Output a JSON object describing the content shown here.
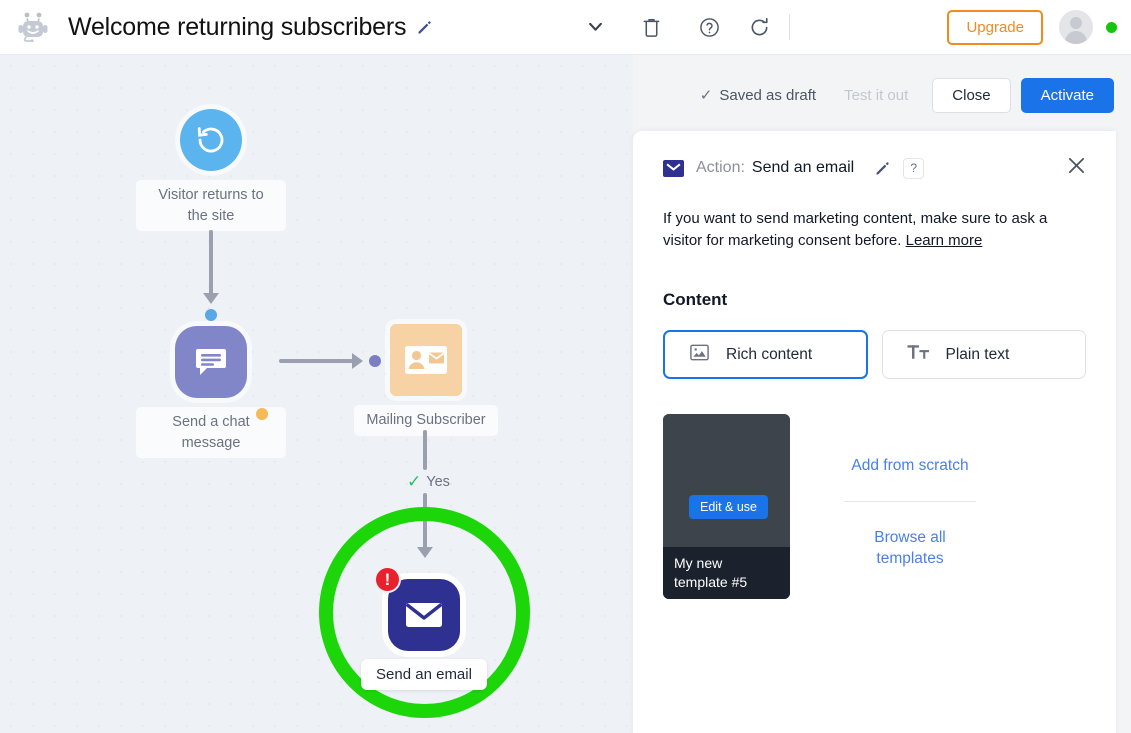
{
  "topbar": {
    "logo_icon": "chatbot-logo-icon",
    "title": "Welcome returning subscribers",
    "title_edit_icon": "pencil-icon",
    "icons": [
      "chevron-down-icon",
      "trash-icon",
      "help-circle-icon",
      "refresh-icon"
    ],
    "upgrade_label": "Upgrade",
    "avatar_icon": "user-avatar",
    "status_color": "#16c60c"
  },
  "actionbar": {
    "saved_label": "Saved as draft",
    "saved_check_icon": "check-icon",
    "test_label": "Test it out",
    "close_label": "Close",
    "activate_label": "Activate",
    "activate_color": "#1a73e8"
  },
  "canvas": {
    "nodes": [
      {
        "id": "trigger",
        "label": "Visitor returns to the site",
        "icon": "rotate-back-icon",
        "color": "#5cb4ef"
      },
      {
        "id": "chat",
        "label": "Send a chat message",
        "icon": "chat-bubble-icon",
        "color": "#8086c8"
      },
      {
        "id": "mailing-subscriber",
        "label": "Mailing Subscriber",
        "icon": "contact-card-icon",
        "color": "#f7d2a4"
      },
      {
        "id": "send-email",
        "label": "Send an email",
        "icon": "envelope-icon",
        "color": "#2f3192",
        "alert": "!",
        "highlight_color": "#1cd60a"
      }
    ],
    "branch_label": "Yes",
    "branch_check_icon": "check-icon",
    "connector_color": "#9aa0b0",
    "dot_colors": {
      "blue": "#58a8e8",
      "orange": "#f7b955",
      "purple": "#7a7fc4"
    }
  },
  "panel": {
    "mail_icon": "envelope-icon",
    "action_word": "Action:",
    "action_name": "Send an email",
    "edit_icon": "pencil-icon",
    "help_label": "?",
    "close_icon": "close-icon",
    "consent_text": "If you want to send marketing content, make sure to ask a visitor for marketing consent before. ",
    "learn_more": "Learn more",
    "section_title": "Content",
    "content_options": [
      {
        "label": "Rich content",
        "icon": "image-icon",
        "active": true
      },
      {
        "label": "Plain text",
        "icon": "text-format-icon",
        "active": false
      }
    ],
    "template": {
      "edit_use_label": "Edit & use",
      "name": "My new template #5"
    },
    "add_from_scratch": "Add from scratch",
    "browse_all_templates": "Browse all templates"
  }
}
